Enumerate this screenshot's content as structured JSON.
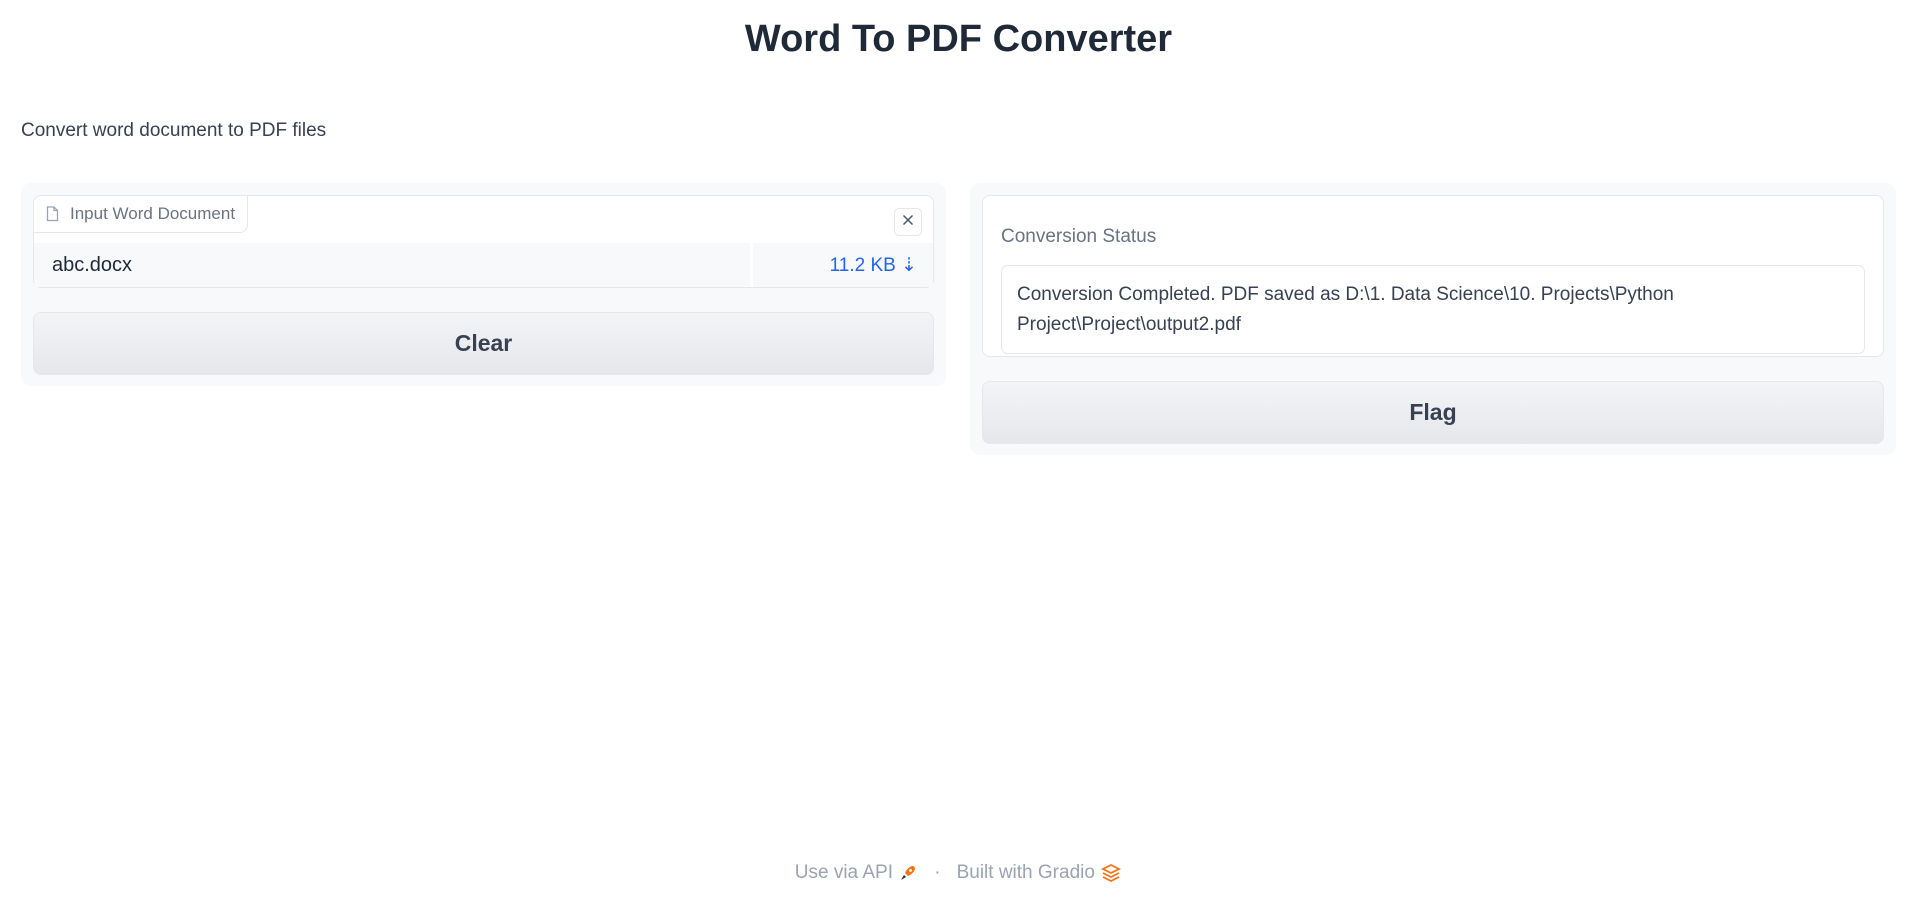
{
  "app": {
    "title": "Word To PDF Converter",
    "description": "Convert word document to PDF files"
  },
  "input": {
    "label": "Input Word Document",
    "file_name": "abc.docx",
    "file_size": "11.2 KB ⇣",
    "clear_label": "Clear"
  },
  "output": {
    "label": "Conversion Status",
    "value": "Conversion Completed. PDF saved as D:\\1. Data Science\\10.  Projects\\Python Project\\Project\\output2.pdf",
    "flag_label": "Flag"
  },
  "footer": {
    "api_label": "Use via API",
    "separator": "·",
    "built_label": "Built with Gradio"
  },
  "colors": {
    "link": "#2563eb",
    "accent": "#f97316"
  },
  "icons": {
    "file": "file-icon",
    "close": "close-icon",
    "api": "rocket-icon",
    "gradio": "gradio-logo-icon"
  }
}
